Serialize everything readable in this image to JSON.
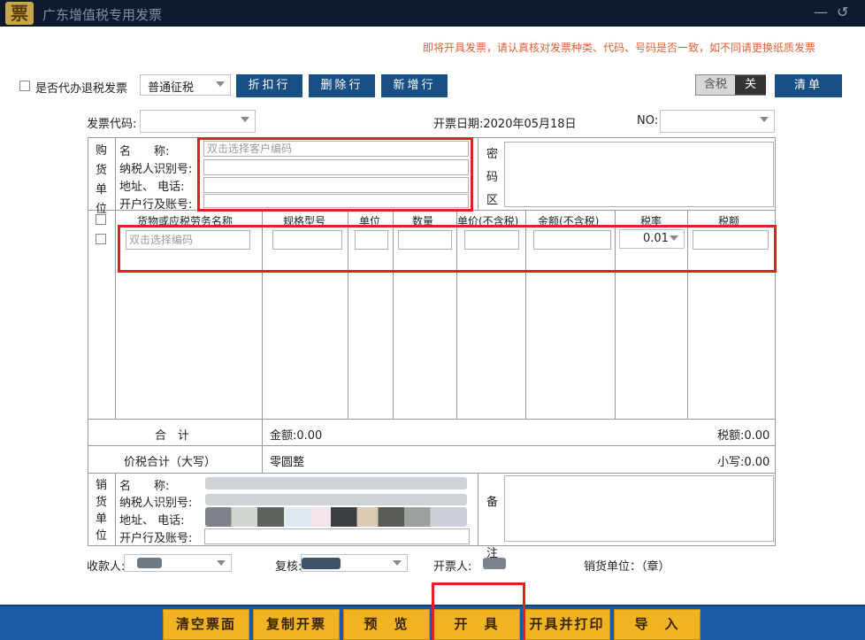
{
  "window": {
    "title": "广东增值税专用发票",
    "logo_text": "票"
  },
  "notice": "即将开具发票，请认真核对发票种类、代码、号码是否一致，如不同请更换纸质发票",
  "toolbar": {
    "agent_refund_label": "是否代办退税发票",
    "tax_type": "普通征税",
    "discount_btn": "折扣行",
    "delete_btn": "删除行",
    "add_btn": "新增行",
    "tax_incl": "含税",
    "tax_toggle_state": "关",
    "list_btn": "清单"
  },
  "header": {
    "code_label": "发票代码:",
    "date_label": "开票日期:2020年05月18日",
    "no_label": "NO:"
  },
  "buyer": {
    "side_label": [
      "购",
      "货",
      "单",
      "位"
    ],
    "name_label": "名　　称:",
    "name_placeholder": "双击选择客户编码",
    "taxid_label": "纳税人识别号:",
    "addr_label": "地址、 电话:",
    "bank_label": "开户行及账号:"
  },
  "secret": {
    "label": [
      "密",
      "码",
      "区"
    ]
  },
  "items": {
    "headers": [
      "货物或应税劳务名称",
      "规格型号",
      "单位",
      "数量",
      "单价(不含税)",
      "金额(不含税)",
      "税率",
      "税额"
    ],
    "name_placeholder": "双击选择编码",
    "tax_rate": "0.01"
  },
  "totals": {
    "sum_label": "合　计",
    "amount": "金额:0.00",
    "tax": "税额:0.00",
    "grand_label": "价税合计（大写）",
    "grand_words": "零圆整",
    "grand_small": "小写:0.00"
  },
  "seller": {
    "side_label": [
      "销",
      "货",
      "单",
      "位"
    ],
    "name_label": "名　　称:",
    "taxid_label": "纳税人识别号:",
    "addr_label": "地址、 电话:",
    "bank_label": "开户行及账号:",
    "remark_label": [
      "备",
      "注"
    ]
  },
  "signers": {
    "payee": "收款人:",
    "reviewer": "复核:",
    "drawer": "开票人:",
    "seller_unit": "销货单位：（章）"
  },
  "footer_buttons": [
    "清空票面",
    "复制开票",
    "预　览",
    "开　具",
    "开具并打印",
    "导　入"
  ]
}
